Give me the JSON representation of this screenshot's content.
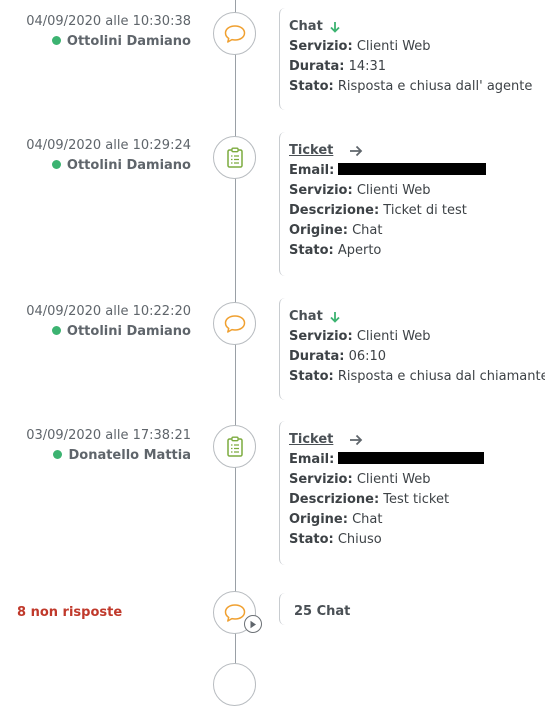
{
  "entries": [
    {
      "timestamp": "04/09/2020 alle 10:30:38",
      "agent": "Ottolini Damiano",
      "type": "Chat",
      "icon": "chat-bubble-icon",
      "rows": [
        {
          "label": "Servizio:",
          "value": "Clienti Web"
        },
        {
          "label": "Durata:",
          "value": "14:31"
        },
        {
          "label": "Stato:",
          "value": "Risposta e chiusa dall' agente"
        }
      ]
    },
    {
      "timestamp": "04/09/2020 alle 10:29:24",
      "agent": "Ottolini Damiano",
      "type": "Ticket",
      "icon": "clipboard-icon",
      "email_label": "Email:",
      "rows": [
        {
          "label": "Servizio:",
          "value": "Clienti Web"
        },
        {
          "label": "Descrizione:",
          "value": "Ticket di test"
        },
        {
          "label": "Origine:",
          "value": "Chat"
        },
        {
          "label": "Stato:",
          "value": "Aperto"
        }
      ]
    },
    {
      "timestamp": "04/09/2020 alle 10:22:20",
      "agent": "Ottolini Damiano",
      "type": "Chat",
      "icon": "chat-bubble-icon",
      "rows": [
        {
          "label": "Servizio:",
          "value": "Clienti Web"
        },
        {
          "label": "Durata:",
          "value": "06:10"
        },
        {
          "label": "Stato:",
          "value": "Risposta e chiusa dal chiamante"
        }
      ]
    },
    {
      "timestamp": "03/09/2020 alle 17:38:21",
      "agent": "Donatello Mattia",
      "type": "Ticket",
      "icon": "clipboard-icon",
      "email_label": "Email:",
      "rows": [
        {
          "label": "Servizio:",
          "value": "Clienti Web"
        },
        {
          "label": "Descrizione:",
          "value": "Test ticket"
        },
        {
          "label": "Origine:",
          "value": "Chat"
        },
        {
          "label": "Stato:",
          "value": "Chiuso"
        }
      ]
    }
  ],
  "unanswered": {
    "label": "8 non risposte",
    "summary": "25 Chat",
    "color": "#c0392b"
  },
  "colors": {
    "chat_icon": "#f0a030",
    "ticket_icon": "#7cab3e",
    "arrow_green": "#3cb371",
    "online_dot": "#3cb371"
  }
}
